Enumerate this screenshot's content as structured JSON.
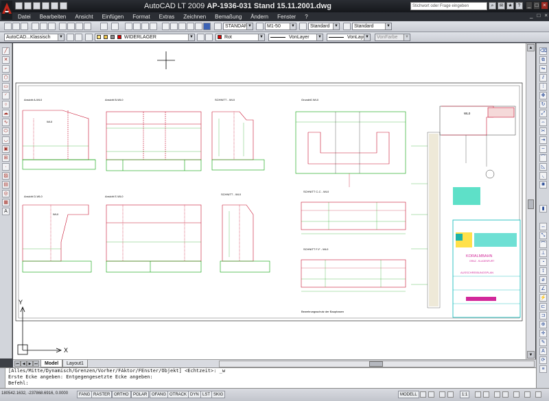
{
  "title": {
    "app": "AutoCAD LT 2009",
    "document": "AP-1936-031 Stand 15.11.2001.dwg",
    "search_placeholder": "Stichwort oder Frage eingeben",
    "help": "?",
    "minimize": "_",
    "maximize": "□",
    "close": "×"
  },
  "menu": [
    "Datei",
    "Bearbeiten",
    "Ansicht",
    "Einfügen",
    "Format",
    "Extras",
    "Zeichnen",
    "Bemaßung",
    "Ändern",
    "Fenster",
    "?"
  ],
  "toolbar1": {
    "text_style": "STANDARD",
    "dim_style": "M1-50",
    "table_style": "Standard",
    "multileader_style": "Standard"
  },
  "toolbar2": {
    "workspace": "AutoCAD...Klassisch",
    "layer": "WIDERLAGER",
    "color": "Rot",
    "color_hex": "#e00000",
    "linetype": "VonLayer",
    "lineweight": "VonLayer",
    "plotstyle": "VonFarbe"
  },
  "drawing": {
    "views": [
      "Ansicht A-WL0",
      "Ansicht B-WL0",
      "SCHNITT - WL0",
      "Grundriß WL0",
      "Ansicht D-WL0",
      "Ansicht E-WL0",
      "SCHNITT - WL0",
      "SCHNITT C-C - WL0",
      "SCHNITT F-F - WL0",
      "Bewehrungsschutz der Bauphasen"
    ],
    "detail_label": "WL0",
    "title_block": {
      "project": "KORALMBAHN",
      "line2": "GRAZ - KLAGENFURT",
      "plan": "AUSSCHREIBUNGSPLAN"
    },
    "ucs_y": "Y",
    "ucs_x": "X"
  },
  "tabs": [
    "Model",
    "Layout1"
  ],
  "command_line": [
    "[Alles/Mitte/Dynamisch/Grenzen/Vorher/FAktor/FEnster/Objekt] <Echtzeit>: _w",
    "Erste Ecke angeben: Entgegengesetzte Ecke angeben:",
    "Befehl:"
  ],
  "status": {
    "coordinates": "180542.1632, -237868.6916, 0.0000",
    "toggles": [
      "FANG",
      "RASTER",
      "ORTHO",
      "POLAR",
      "OFANG",
      "OTRACK",
      "DYN",
      "LST",
      "SKIG"
    ],
    "space": "MODELL",
    "scale": "1:1"
  }
}
